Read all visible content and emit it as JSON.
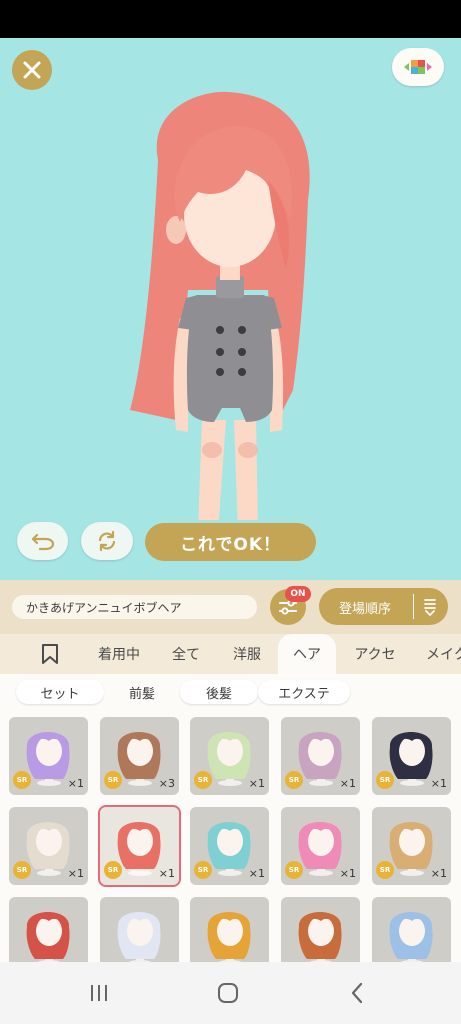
{
  "stage": {
    "ok_label": "これでOK！"
  },
  "filter": {
    "item_name": "かきあげアンニュイボブヘア",
    "filter_badge": "ON",
    "sort_label": "登場順序"
  },
  "tabs": [
    {
      "label": ""
    },
    {
      "label": "着用中"
    },
    {
      "label": "全て"
    },
    {
      "label": "洋服"
    },
    {
      "label": "ヘア"
    },
    {
      "label": "アクセ"
    },
    {
      "label": "メイク"
    }
  ],
  "active_tab": "ヘア",
  "subtabs": [
    {
      "label": "セット"
    },
    {
      "label": "前髪"
    },
    {
      "label": "後髪"
    },
    {
      "label": "エクステ"
    }
  ],
  "active_subtab": "前髪",
  "items": [
    {
      "hair": "#b99ae4",
      "rarity": "SR",
      "qty": "×1"
    },
    {
      "hair": "#b0785a",
      "rarity": "SR",
      "qty": "×3"
    },
    {
      "hair": "#cfe4b4",
      "rarity": "SR",
      "qty": "×1"
    },
    {
      "hair": "#c8a4c0",
      "rarity": "SR",
      "qty": "×1"
    },
    {
      "hair": "#2f2f44",
      "rarity": "SR",
      "qty": "×1"
    },
    {
      "hair": "#e4ddcf",
      "rarity": "SR",
      "qty": "×1"
    },
    {
      "hair": "#e87064",
      "rarity": "SR",
      "qty": "×1"
    },
    {
      "hair": "#7fd0d2",
      "rarity": "SR",
      "qty": "×1"
    },
    {
      "hair": "#f08ab6",
      "rarity": "SR",
      "qty": "×1"
    },
    {
      "hair": "#d9ae74",
      "rarity": "SR",
      "qty": "×1"
    },
    {
      "hair": "#d45248",
      "rarity": "",
      "qty": ""
    },
    {
      "hair": "#e2e6f2",
      "rarity": "",
      "qty": ""
    },
    {
      "hair": "#e7a436",
      "rarity": "",
      "qty": ""
    },
    {
      "hair": "#c86c3c",
      "rarity": "",
      "qty": ""
    },
    {
      "hair": "#9cc0e6",
      "rarity": "",
      "qty": ""
    }
  ],
  "selected_index": 6,
  "colors": {
    "stage_bg": "#a5e6e4",
    "gold": "#c4a455",
    "badge_red": "#e9524c",
    "selected_outline": "#e36a7b",
    "sr_badge": "#e9b436"
  }
}
